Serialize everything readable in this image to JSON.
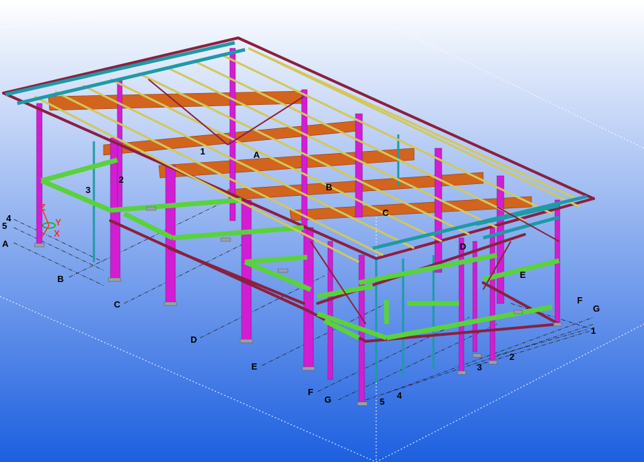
{
  "viewport": {
    "background_top": "#ffffff",
    "background_bottom": "#1c5fe0"
  },
  "grid_labels": {
    "lines_left": [
      "4",
      "5",
      "A",
      "B",
      "C",
      "D",
      "E",
      "F",
      "G"
    ],
    "lines_bottom": [
      "5",
      "4",
      "3",
      "2",
      "1"
    ],
    "lines_right": [
      "F",
      "G"
    ],
    "on_model": [
      "1",
      "2",
      "3",
      "A",
      "B",
      "C",
      "D",
      "E"
    ]
  },
  "axes": {
    "z": "Z",
    "y": "Y",
    "x": "X",
    "z_color": "#ff2a2a",
    "y_color": "#ff2a2a",
    "x_color": "#ff2a2a",
    "gizmo_color": "#00b400"
  },
  "colors": {
    "column_magenta": "#d21ed2",
    "beam_maroon": "#8a2040",
    "beam_green": "#5ad23c",
    "purlin_yellow": "#d2c85a",
    "rafter_teal": "#1e9aa8",
    "rafter_orange": "#d2641e",
    "column_teal": "#1e9aa8"
  }
}
